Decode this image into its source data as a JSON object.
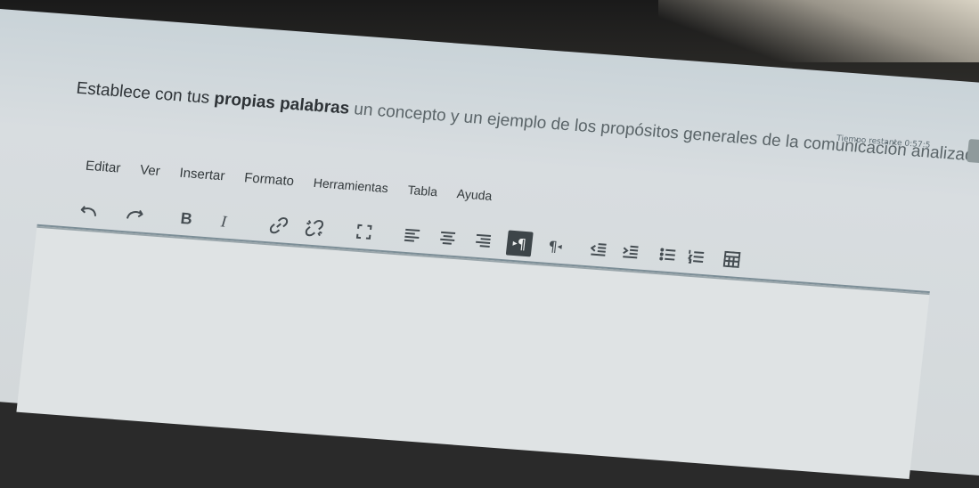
{
  "prompt": {
    "part1": "Establece con tus ",
    "bold": "propias palabras",
    "part2": " un concepto y un ejemplo de los propósitos generales de la comunicación analizados en clase."
  },
  "timer": {
    "label": "Tiempo restante 0:57:5"
  },
  "menubar": {
    "items": [
      "Editar",
      "Ver",
      "Insertar",
      "Formato",
      "Herramientas",
      "Tabla",
      "Ayuda"
    ]
  },
  "toolbar": {
    "undo_icon": "undo-icon",
    "redo_icon": "redo-icon",
    "bold_label": "B",
    "italic_label": "I",
    "ltr_label": "¶",
    "rtl_label": "¶"
  },
  "colors": {
    "screen_bg": "#d3d8da",
    "text": "#2e3337",
    "active_button": "#3d4549"
  }
}
